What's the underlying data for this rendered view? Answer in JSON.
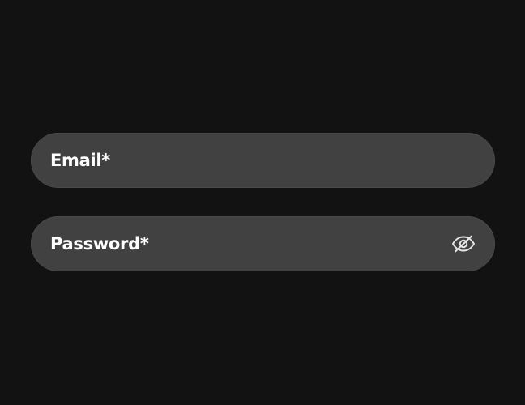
{
  "form": {
    "email": {
      "placeholder": "Email*",
      "value": ""
    },
    "password": {
      "placeholder": "Password*",
      "value": "",
      "toggle_icon": "eye-off-icon"
    }
  },
  "colors": {
    "background": "#121212",
    "field_background": "#414141",
    "text": "#ffffff",
    "icon": "#e6e6e6"
  }
}
